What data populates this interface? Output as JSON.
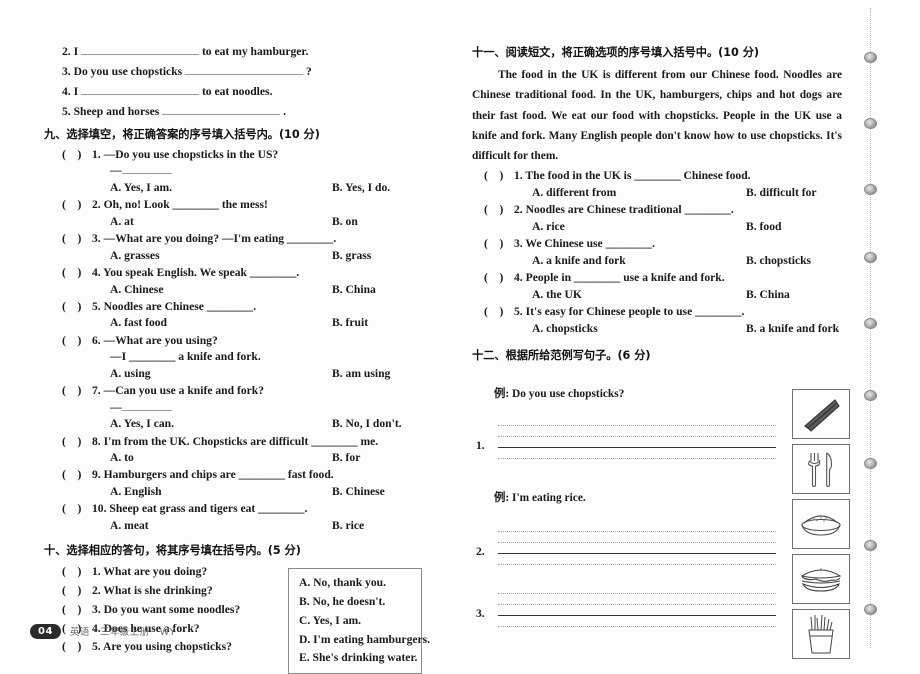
{
  "page": {
    "number": "04",
    "footer_text": "英语 · 三年级上册 · WY"
  },
  "left_column": {
    "carryover_items": [
      {
        "num": "2.",
        "pre": "I",
        "post": "to eat my hamburger."
      },
      {
        "num": "3.",
        "pre": "Do you use chopsticks",
        "post": "?"
      },
      {
        "num": "4.",
        "pre": "I",
        "post": "to eat noodles."
      },
      {
        "num": "5.",
        "pre": "Sheep and horses",
        "post": "."
      }
    ],
    "section_nine": {
      "heading": "九、选择填空，将正确答案的序号填入括号内。(10 分)",
      "questions": [
        {
          "num": "1.",
          "stem": "—Do you use chopsticks in the US?",
          "stem2": "—",
          "a": "A. Yes, I am.",
          "b": "B. Yes, I do."
        },
        {
          "num": "2.",
          "stem": "Oh, no! Look ________ the mess!",
          "stem2": "",
          "a": "A. at",
          "b": "B. on"
        },
        {
          "num": "3.",
          "stem": "—What are you doing?    —I'm eating ________.",
          "stem2": "",
          "a": "A. grasses",
          "b": "B. grass"
        },
        {
          "num": "4.",
          "stem": "You speak English. We speak ________.",
          "stem2": "",
          "a": "A. Chinese",
          "b": "B. China"
        },
        {
          "num": "5.",
          "stem": "Noodles are Chinese ________.",
          "stem2": "",
          "a": "A. fast food",
          "b": "B. fruit"
        },
        {
          "num": "6.",
          "stem": "—What are you using?",
          "stem2": "—I ________ a knife and fork.",
          "a": "A. using",
          "b": "B. am using"
        },
        {
          "num": "7.",
          "stem": "—Can you use a knife and fork?",
          "stem2": "—",
          "a": "A. Yes, I can.",
          "b": "B. No, I don't."
        },
        {
          "num": "8.",
          "stem": "I'm from the UK. Chopsticks are difficult ________ me.",
          "stem2": "",
          "a": "A. to",
          "b": "B. for"
        },
        {
          "num": "9.",
          "stem": "Hamburgers and chips are ________ fast food.",
          "stem2": "",
          "a": "A. English",
          "b": "B. Chinese"
        },
        {
          "num": "10.",
          "stem": "Sheep eat grass and tigers eat ________.",
          "stem2": "",
          "a": "A. meat",
          "b": "B. rice"
        }
      ]
    },
    "section_ten": {
      "heading": "十、选择相应的答句，将其序号填在括号内。(5 分)",
      "prompts": [
        {
          "num": "1.",
          "text": "What are you doing?"
        },
        {
          "num": "2.",
          "text": "What is she drinking?"
        },
        {
          "num": "3.",
          "text": "Do you want some noodles?"
        },
        {
          "num": "4.",
          "text": "Does he use a fork?"
        },
        {
          "num": "5.",
          "text": "Are you using chopsticks?"
        }
      ],
      "answers": [
        "A. No, thank you.",
        "B. No, he doesn't.",
        "C. Yes, I am.",
        "D. I'm eating hamburgers.",
        "E. She's drinking water."
      ]
    }
  },
  "right_column": {
    "section_eleven": {
      "heading": "十一、阅读短文，将正确选项的序号填入括号中。(10 分)",
      "passage": "The food in the UK is different from our Chinese food. Noodles are Chinese traditional food. In the UK, hamburgers, chips and hot dogs are their fast food. We eat our food with chopsticks. People in the UK use a knife and fork. Many English people don't know how to use chopsticks. It's difficult for them.",
      "questions": [
        {
          "num": "1.",
          "stem": "The food in the UK is ________ Chinese food.",
          "a": "A. different from",
          "b": "B. difficult for"
        },
        {
          "num": "2.",
          "stem": "Noodles are Chinese traditional ________.",
          "a": "A. rice",
          "b": "B. food"
        },
        {
          "num": "3.",
          "stem": "We Chinese use ________.",
          "a": "A. a knife and fork",
          "b": "B. chopsticks"
        },
        {
          "num": "4.",
          "stem": "People in ________ use a knife and fork.",
          "a": "A. the UK",
          "b": "B. China"
        },
        {
          "num": "5.",
          "stem": "It's easy for Chinese people to use ________.",
          "a": "A. chopsticks",
          "b": "B. a knife and fork"
        }
      ]
    },
    "section_twelve": {
      "heading": "十二、根据所给范例写句子。(6 分)",
      "example_one": "例: Do you use chopsticks?",
      "example_two": "例: I'm eating rice.",
      "answer_numbers": [
        "1.",
        "2.",
        "3."
      ],
      "pictures": [
        "chopsticks-icon",
        "fork-and-knife-icon",
        "rice-bowl-icon",
        "hamburger-icon",
        "french-fries-icon"
      ]
    }
  }
}
